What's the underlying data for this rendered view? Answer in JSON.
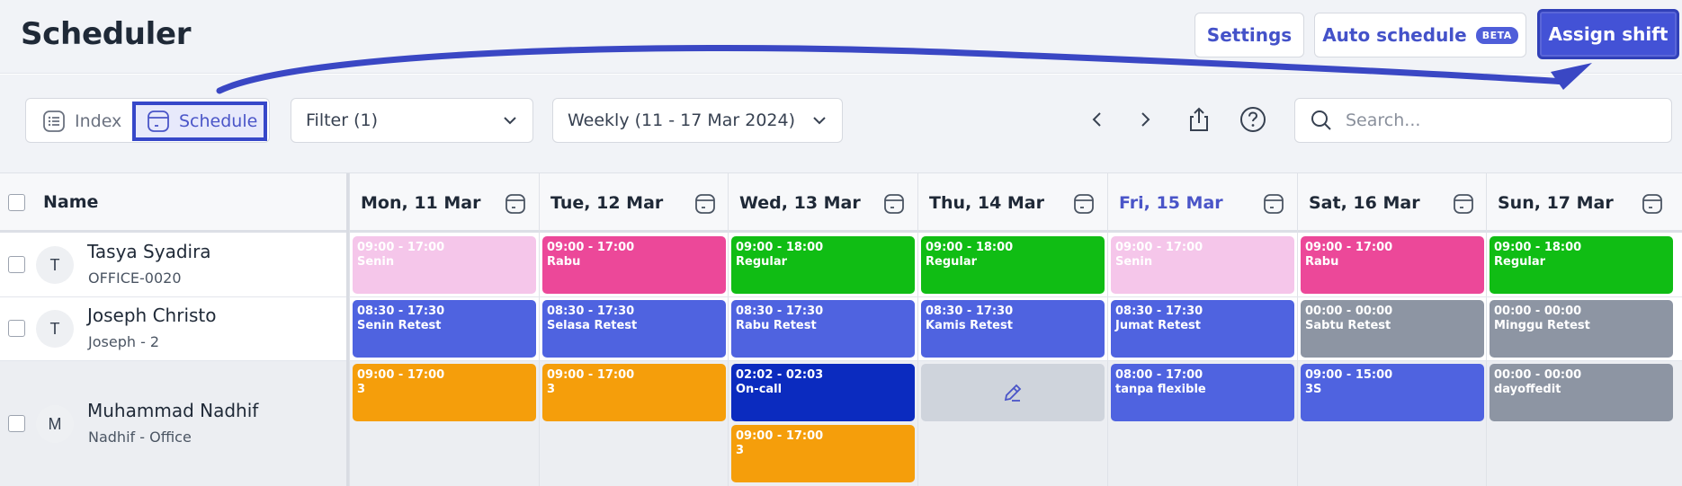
{
  "header": {
    "title": "Scheduler",
    "settings_label": "Settings",
    "auto_schedule_label": "Auto schedule",
    "beta_badge": "BETA",
    "assign_shift_label": "Assign shift"
  },
  "toolbar": {
    "view_index_label": "Index",
    "view_schedule_label": "Schedule",
    "filter_label": "Filter (1)",
    "period_label": "Weekly (11 - 17 Mar 2024)",
    "search_placeholder": "Search..."
  },
  "grid": {
    "name_header": "Name",
    "days": [
      {
        "label": "Mon, 11 Mar",
        "today": false
      },
      {
        "label": "Tue, 12 Mar",
        "today": false
      },
      {
        "label": "Wed, 13 Mar",
        "today": false
      },
      {
        "label": "Thu, 14 Mar",
        "today": false
      },
      {
        "label": "Fri, 15 Mar",
        "today": true
      },
      {
        "label": "Sat, 16 Mar",
        "today": false
      },
      {
        "label": "Sun, 17 Mar",
        "today": false
      }
    ],
    "employees": [
      {
        "initial": "T",
        "name": "Tasya Syadira",
        "sub": "OFFICE-0020"
      },
      {
        "initial": "T",
        "name": "Joseph Christo",
        "sub": "Joseph - 2"
      },
      {
        "initial": "M",
        "name": "Muhammad Nadhif",
        "sub": "Nadhif - Office"
      }
    ],
    "shifts": [
      [
        [
          {
            "time": "09:00 - 17:00",
            "name": "Senin",
            "color": "#f5c6ea",
            "text": "#ffffff"
          }
        ],
        [
          {
            "time": "09:00 - 17:00",
            "name": "Rabu",
            "color": "#ec4899",
            "text": "#ffffff"
          }
        ],
        [
          {
            "time": "09:00 - 18:00",
            "name": "Regular",
            "color": "#10bd14",
            "text": "#ffffff"
          }
        ],
        [
          {
            "time": "09:00 - 18:00",
            "name": "Regular",
            "color": "#10bd14",
            "text": "#ffffff"
          }
        ],
        [
          {
            "time": "09:00 - 17:00",
            "name": "Senin",
            "color": "#f5c6ea",
            "text": "#ffffff"
          }
        ],
        [
          {
            "time": "09:00 - 17:00",
            "name": "Rabu",
            "color": "#ec4899",
            "text": "#ffffff"
          }
        ],
        [
          {
            "time": "09:00 - 18:00",
            "name": "Regular",
            "color": "#10bd14",
            "text": "#ffffff"
          }
        ]
      ],
      [
        [
          {
            "time": "08:30 - 17:30",
            "name": "Senin Retest",
            "color": "#4f63e0",
            "text": "#ffffff"
          }
        ],
        [
          {
            "time": "08:30 - 17:30",
            "name": "Selasa Retest",
            "color": "#4f63e0",
            "text": "#ffffff"
          }
        ],
        [
          {
            "time": "08:30 - 17:30",
            "name": "Rabu Retest",
            "color": "#4f63e0",
            "text": "#ffffff"
          }
        ],
        [
          {
            "time": "08:30 - 17:30",
            "name": "Kamis Retest",
            "color": "#4f63e0",
            "text": "#ffffff"
          }
        ],
        [
          {
            "time": "08:30 - 17:30",
            "name": "Jumat Retest",
            "color": "#4f63e0",
            "text": "#ffffff"
          }
        ],
        [
          {
            "time": "00:00 - 00:00",
            "name": "Sabtu Retest",
            "color": "#8d95a3",
            "text": "#ffffff"
          }
        ],
        [
          {
            "time": "00:00 - 00:00",
            "name": "Minggu Retest",
            "color": "#8d95a3",
            "text": "#ffffff"
          }
        ]
      ],
      [
        [
          {
            "time": "09:00 - 17:00",
            "name": "3",
            "color": "#f59e0b",
            "text": "#ffffff"
          }
        ],
        [
          {
            "time": "09:00 - 17:00",
            "name": "3",
            "color": "#f59e0b",
            "text": "#ffffff"
          }
        ],
        [
          {
            "time": "02:02 - 02:03",
            "name": "On-call",
            "color": "#0b2bbf",
            "text": "#ffffff"
          },
          {
            "time": "09:00 - 17:00",
            "name": "3",
            "color": "#f59e0b",
            "text": "#ffffff"
          }
        ],
        [],
        [
          {
            "time": "08:00 - 17:00",
            "name": "tanpa flexible",
            "color": "#4f63e0",
            "text": "#ffffff"
          }
        ],
        [
          {
            "time": "09:00 - 15:00",
            "name": "3S",
            "color": "#4f63e0",
            "text": "#ffffff"
          }
        ],
        [
          {
            "time": "00:00 - 00:00",
            "name": "dayoffedit",
            "color": "#8d95a3",
            "text": "#ffffff"
          }
        ]
      ]
    ]
  },
  "colors": {
    "accent": "#4352d6",
    "annotation": "#3a47c4"
  }
}
